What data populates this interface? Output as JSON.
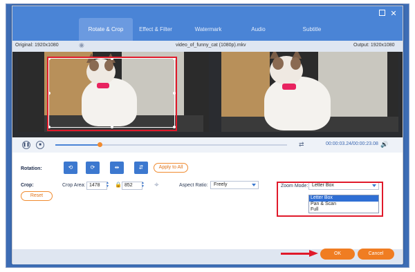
{
  "tabs": [
    {
      "label": "Rotate & Crop",
      "active": true
    },
    {
      "label": "Effect & Filter",
      "active": false
    },
    {
      "label": "Watermark",
      "active": false
    },
    {
      "label": "Audio",
      "active": false
    },
    {
      "label": "Subtitle",
      "active": false
    }
  ],
  "info": {
    "original": "Original: 1920x1080",
    "filename": "video_of_funny_cat (1080p).mkv",
    "output": "Output: 1920x1080"
  },
  "playback": {
    "timecode": "00:00:03.24/00:00:23.08",
    "progress": 0.19
  },
  "rotation": {
    "label": "Rotation:",
    "apply_all": "Apply to All",
    "icons": [
      "rotate-left-icon",
      "rotate-right-icon",
      "flip-horizontal-icon",
      "flip-vertical-icon"
    ]
  },
  "crop": {
    "label": "Crop:",
    "reset": "Reset",
    "area_label": "Crop Area:",
    "width": "1478",
    "height": "852"
  },
  "aspect": {
    "label": "Aspect Ratio:",
    "value": "Freely"
  },
  "zoom": {
    "label": "Zoom Mode:",
    "value": "Letter Box",
    "options": [
      "Letter Box",
      "Pan & Scan",
      "Full"
    ],
    "selected_index": 0
  },
  "footer": {
    "ok": "OK",
    "cancel": "Cancel"
  },
  "colors": {
    "accent_blue": "#4a84d6",
    "orange": "#f07d22",
    "annotation_red": "#e0192a"
  }
}
